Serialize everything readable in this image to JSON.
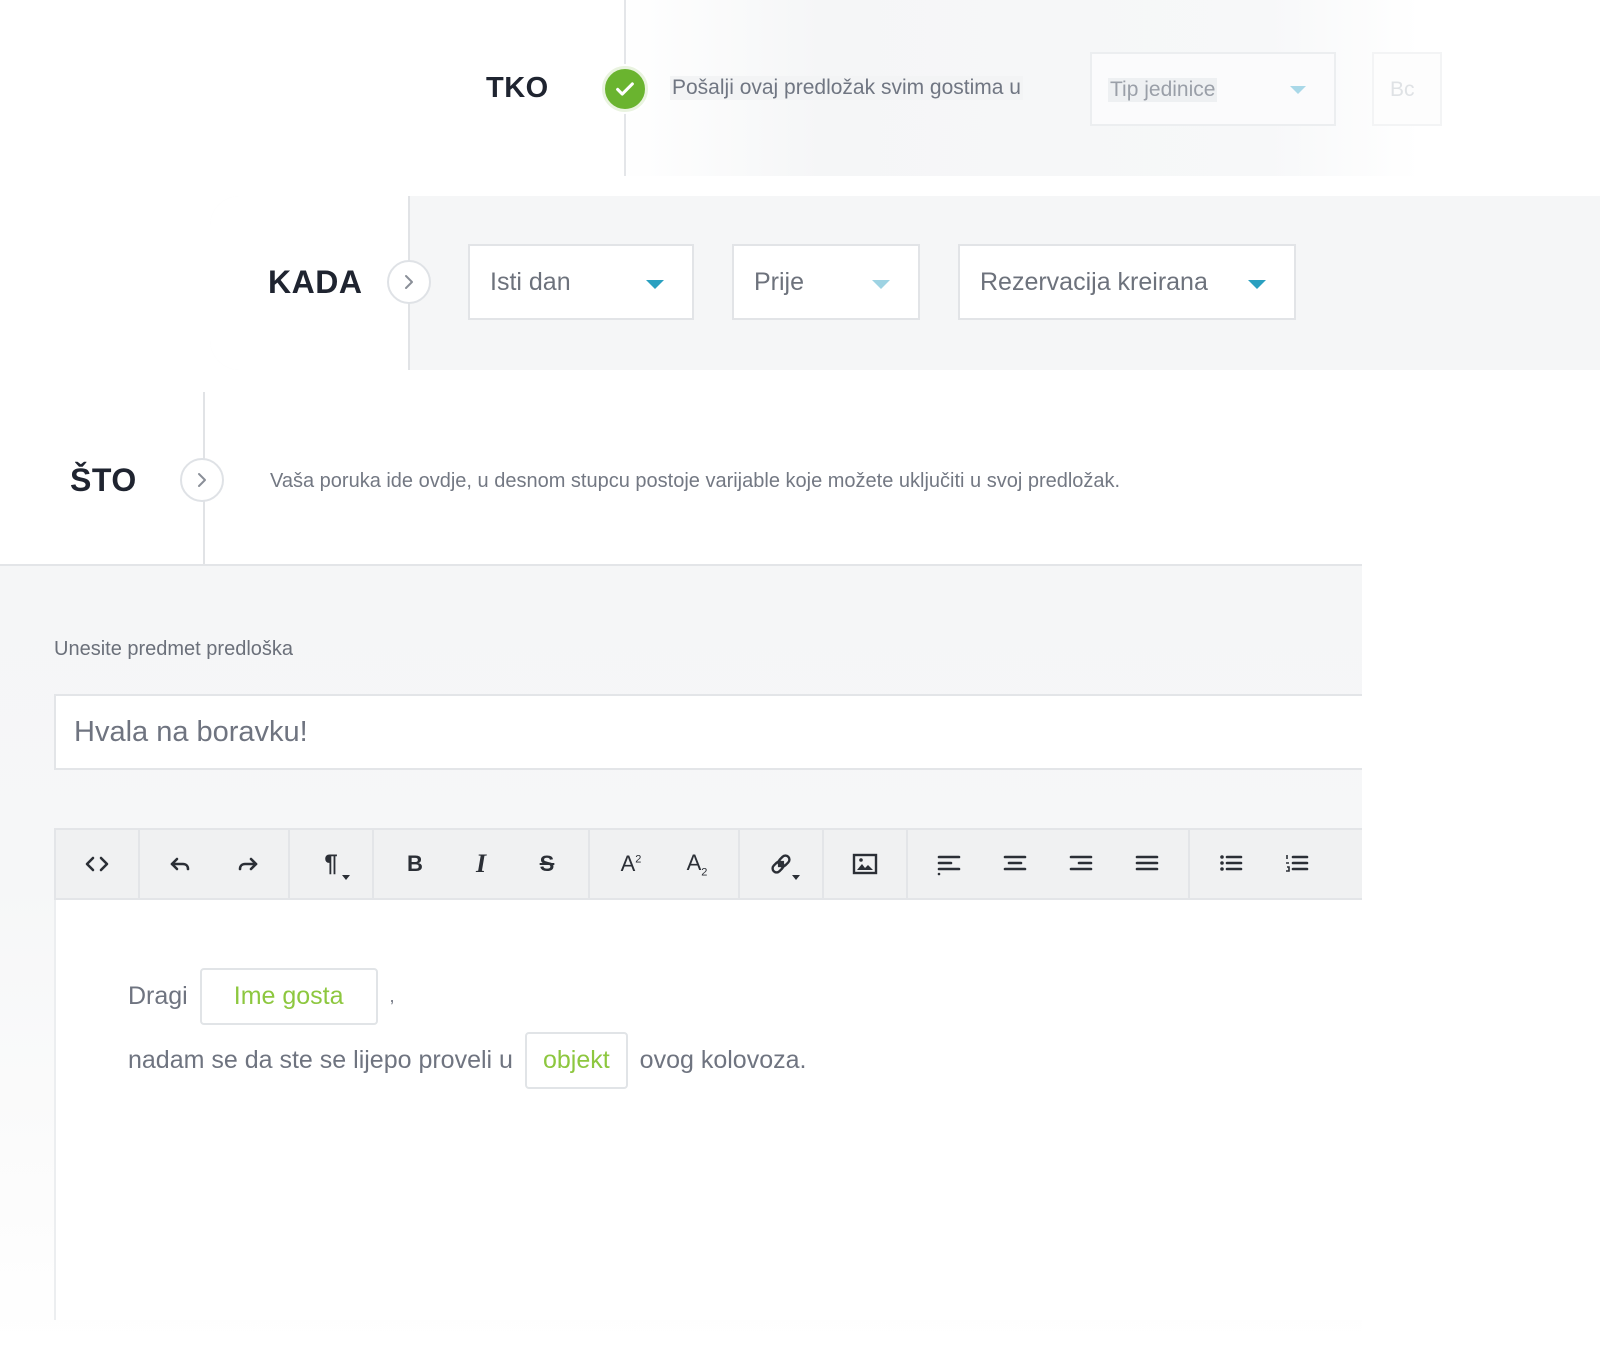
{
  "tko": {
    "label": "TKO",
    "description": "Pošalji ovaj predložak svim gostima u",
    "unit_type_select": "Tip jedinice",
    "faded_select": "Bc"
  },
  "kada": {
    "label": "KADA",
    "day_select": "Isti dan",
    "relation_select": "Prije",
    "event_select": "Rezervacija kreirana"
  },
  "sto": {
    "label": "ŠTO",
    "description": "Vaša poruka ide ovdje, u desnom stupcu postoje varijable koje možete uključiti u svoj predložak."
  },
  "editor": {
    "subject_label": "Unesite predmet predloška",
    "subject_value": "Hvala na boravku!",
    "toolbar_icons": [
      "code-view-icon",
      "undo-icon",
      "redo-icon",
      "paragraph-format-icon",
      "bold-icon",
      "italic-icon",
      "strikethrough-icon",
      "superscript-icon",
      "subscript-icon",
      "link-icon",
      "image-icon",
      "align-left-icon",
      "align-center-icon",
      "align-right-icon",
      "align-justify-icon",
      "unordered-list-icon",
      "ordered-list-icon"
    ],
    "body": {
      "line1_prefix": "Dragi",
      "guest_name_chip": "Ime gosta",
      "line1_suffix": ",",
      "line2_prefix": "nadam se da ste se lijepo proveli u",
      "property_chip": "objekt",
      "line2_suffix": "ovog kolovoza."
    }
  },
  "colors": {
    "accent_green": "#6ab42f",
    "chip_text_green": "#8dc73f",
    "caret_blue": "#2aa0c0"
  }
}
